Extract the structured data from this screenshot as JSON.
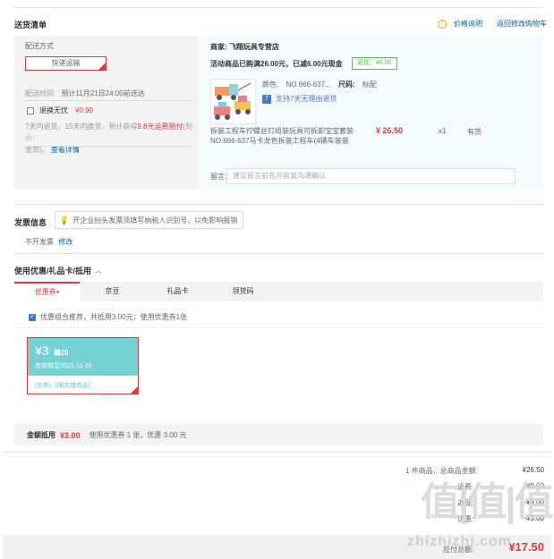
{
  "delivery": {
    "title": "送货清单",
    "price_note_label": "价格说明",
    "back_to_cart": "返回修改购物车",
    "method_label": "配送方式",
    "method_value": "快递运输",
    "time_label": "配送时间:",
    "time_value": "预计11月21日24:00前送达",
    "insurance_label": "退换无忧",
    "insurance_price": "¥0.90",
    "insurance_desc_1": "7天内退货，15天内换货，预计获得",
    "insurance_desc_red": "9.8元运费赔付",
    "insurance_desc_2": "(到小",
    "insurance_desc_3": "金库)。",
    "insurance_detail_link": "查看详情"
  },
  "shop": {
    "merchant_label": "商家:",
    "merchant_name": "飞翔玩具专营店",
    "promo_text": "活动商品已购满26.00元，已减6.00元现金",
    "promo_badge": "返现：¥6.00",
    "product": {
      "color_label": "颜色:",
      "color_value": "NO.666-637...",
      "size_label": "尺码:",
      "size_value": "标配",
      "return_badge": "支持7天无理由退货",
      "title_line1": "拆装工程车拧螺丝钉组装玩具可拆卸宝宝套装",
      "title_line2": "NO.666-637马卡龙色拆装工程车(4辆车装装",
      "price": "¥ 26.50",
      "quantity": "x1",
      "stock": "有货"
    },
    "message_label": "留言:",
    "message_placeholder": "建议留言前先与商家沟通确认"
  },
  "invoice": {
    "title": "发票信息",
    "tip": "开企业抬头发票须填写纳税人识别号，以免影响报销",
    "value": "不开发票",
    "edit_link": "修改"
  },
  "discount": {
    "title": "使用优惠/礼品卡/抵用",
    "tabs": [
      "优惠券",
      "京豆",
      "礼品卡",
      "领货码"
    ],
    "combo_checkbox_text": "优惠组合推荐，共抵用3.00元：使用优惠券1张",
    "coupon": {
      "amount": "¥3",
      "condition": "满20",
      "validity": "有效期至2021-11-19",
      "tag1": "[东券]",
      "tag2": "[限店铺商品]"
    },
    "summary_label": "金额抵用",
    "summary_amount": "¥3.00",
    "summary_detail": "使用优惠券 1 张，优惠 3.00 元"
  },
  "totals": {
    "count_num": "1",
    "count_text": "件商品，总商品金额:",
    "goods_amount": "¥26.50",
    "freight_label": "运费:",
    "freight_value": "¥0.00",
    "row3_label": "返现:",
    "row3_value": "-¥6.00",
    "row4_label": "优惠:",
    "row4_value": "-¥3.00",
    "payable_label": "应付总额:",
    "payable_value": "¥17.50"
  },
  "watermark": {
    "logo_text": "值|值|值",
    "site": "zhizhizhi.com"
  },
  "colors": {
    "accent_red": "#e4393c",
    "link_blue": "#005ea7",
    "coupon_teal": "#74d2d4",
    "promo_green": "#5cb85c"
  }
}
